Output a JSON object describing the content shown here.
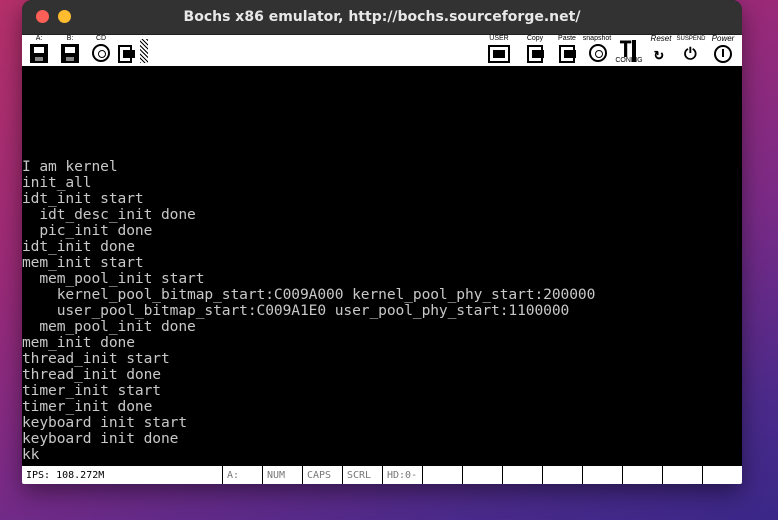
{
  "window": {
    "title": "Bochs x86 emulator, http://bochs.sourceforge.net/"
  },
  "toolbar": {
    "floppy_a": "A:",
    "floppy_b": "B:",
    "cdrom": "CD",
    "user": "USER",
    "copy": "Copy",
    "paste": "Paste",
    "snapshot": "snapshot",
    "config": "CONFIG",
    "reset": "Reset",
    "suspend": "SUSPEND",
    "power": "Power"
  },
  "console": {
    "lines": [
      "I am kernel",
      "init_all",
      "idt_init start",
      "  idt_desc_init done",
      "  pic_init done",
      "idt_init done",
      "mem_init start",
      "  mem_pool_init start",
      "    kernel_pool_bitmap_start:C009A000 kernel_pool_phy_start:200000",
      "    user_pool_bitmap_start:C009A1E0 user_pool_phy_start:1100000",
      "  mem_pool_init done",
      "mem_init done",
      "thread_init start",
      "thread_init done",
      "timer_init start",
      "timer_init done",
      "keyboard init start",
      "keyboard init done",
      "kk"
    ]
  },
  "status": {
    "ips": "IPS: 108.272M",
    "drive_a": "A:",
    "num": "NUM",
    "caps": "CAPS",
    "scrl": "SCRL",
    "hd": "HD:0-M"
  }
}
